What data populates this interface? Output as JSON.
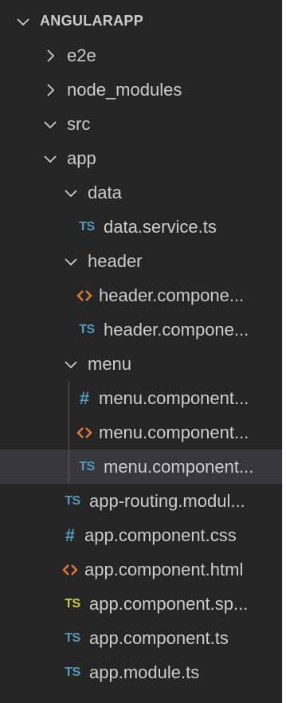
{
  "explorer": {
    "colors": {
      "background": "#252526",
      "text": "#cccccc",
      "selected_row": "#37373d",
      "ts_icon": "#519aba",
      "spec_icon": "#cbcb41",
      "css_icon": "#519aba",
      "html_icon": "#e37933"
    },
    "items": [
      {
        "label": "ANGULARAPP",
        "kind": "folder",
        "state": "expanded",
        "depth": 0,
        "icon": "chevron-down-icon"
      },
      {
        "label": "e2e",
        "kind": "folder",
        "state": "collapsed",
        "depth": 1,
        "icon": "chevron-right-icon"
      },
      {
        "label": "node_modules",
        "kind": "folder",
        "state": "collapsed",
        "depth": 1,
        "icon": "chevron-right-icon"
      },
      {
        "label": "src",
        "kind": "folder",
        "state": "expanded",
        "depth": 1,
        "icon": "chevron-down-icon"
      },
      {
        "label": "app",
        "kind": "folder",
        "state": "expanded",
        "depth": 2,
        "icon": "chevron-down-icon"
      },
      {
        "label": "data",
        "kind": "folder",
        "state": "expanded",
        "depth": 3,
        "icon": "chevron-down-icon"
      },
      {
        "label": "data.service.ts",
        "kind": "file",
        "filetype": "ts",
        "icon_text": "TS",
        "icon": "typescript-file-icon",
        "depth": 4
      },
      {
        "label": "header",
        "kind": "folder",
        "state": "expanded",
        "depth": 3,
        "icon": "chevron-down-icon"
      },
      {
        "label": "header.compone...",
        "kind": "file",
        "filetype": "html",
        "icon": "html-file-icon",
        "depth": 4
      },
      {
        "label": "header.compone...",
        "kind": "file",
        "filetype": "ts",
        "icon_text": "TS",
        "icon": "typescript-file-icon",
        "depth": 4
      },
      {
        "label": "menu",
        "kind": "folder",
        "state": "expanded",
        "depth": 3,
        "icon": "chevron-down-icon"
      },
      {
        "label": "menu.component...",
        "kind": "file",
        "filetype": "css",
        "icon_text": "#",
        "icon": "css-file-icon",
        "depth": 4
      },
      {
        "label": "menu.component...",
        "kind": "file",
        "filetype": "html",
        "icon": "html-file-icon",
        "depth": 4
      },
      {
        "label": "menu.component...",
        "kind": "file",
        "filetype": "ts",
        "icon_text": "TS",
        "icon": "typescript-file-icon",
        "depth": 4,
        "selected": true
      },
      {
        "label": "app-routing.modul...",
        "kind": "file",
        "filetype": "ts",
        "icon_text": "TS",
        "icon": "typescript-file-icon",
        "depth": 3
      },
      {
        "label": "app.component.css",
        "kind": "file",
        "filetype": "css",
        "icon_text": "#",
        "icon": "css-file-icon",
        "depth": 3
      },
      {
        "label": "app.component.html",
        "kind": "file",
        "filetype": "html",
        "icon": "html-file-icon",
        "depth": 3
      },
      {
        "label": "app.component.sp...",
        "kind": "file",
        "filetype": "spec",
        "icon_text": "TS",
        "icon": "typescript-spec-file-icon",
        "depth": 3
      },
      {
        "label": "app.component.ts",
        "kind": "file",
        "filetype": "ts",
        "icon_text": "TS",
        "icon": "typescript-file-icon",
        "depth": 3
      },
      {
        "label": "app.module.ts",
        "kind": "file",
        "filetype": "ts",
        "icon_text": "TS",
        "icon": "typescript-file-icon",
        "depth": 3
      }
    ]
  }
}
